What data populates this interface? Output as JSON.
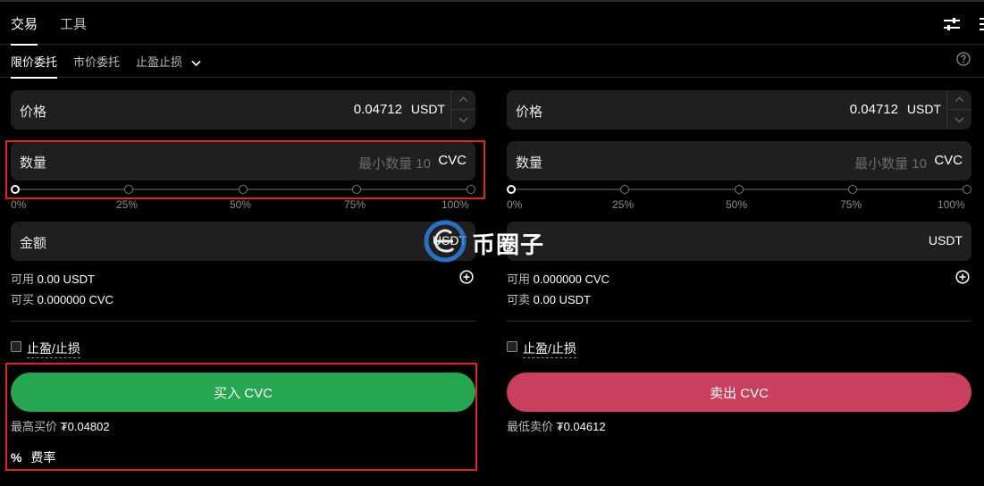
{
  "header": {
    "tabs": [
      {
        "label": "交易",
        "active": true
      },
      {
        "label": "工具",
        "active": false
      }
    ],
    "settings_icon": "sliders-icon"
  },
  "order_types": {
    "limit": "限价委托",
    "market": "市价委托",
    "tpsl": "止盈止损",
    "help_icon": "question-circle-icon"
  },
  "buy": {
    "price_label": "价格",
    "price_value": "0.04712",
    "price_unit": "USDT",
    "qty_label": "数量",
    "qty_placeholder": "最小数量 10",
    "qty_unit": "CVC",
    "slider_ticks": [
      "0%",
      "25%",
      "50%",
      "75%",
      "100%"
    ],
    "slider_value_percent": 0,
    "amount_label": "金额",
    "amount_unit": "USDT",
    "available_key": "可用",
    "available_value": "0.00 USDT",
    "can_key": "可买",
    "can_value": "0.000000 CVC",
    "tpsl_label": "止盈/止损",
    "button": "买入 CVC",
    "best_key": "最高买价",
    "best_value": "₮0.04802",
    "fee_symbol": "%",
    "fee_label": "费率"
  },
  "sell": {
    "price_label": "价格",
    "price_value": "0.04712",
    "price_unit": "USDT",
    "qty_label": "数量",
    "qty_placeholder": "最小数量 10",
    "qty_unit": "CVC",
    "slider_ticks": [
      "0%",
      "25%",
      "50%",
      "75%",
      "100%"
    ],
    "slider_value_percent": 0,
    "amount_unit": "USDT",
    "available_key": "可用",
    "available_value": "0.000000 CVC",
    "can_key": "可卖",
    "can_value": "0.00 USDT",
    "tpsl_label": "止盈/止损",
    "button": "卖出 CVC",
    "best_key": "最低卖价",
    "best_value": "₮0.04612"
  },
  "watermark": {
    "text": "币圈子"
  },
  "colors": {
    "buy": "#26a650",
    "sell": "#c9405f",
    "highlight_box": "#e0241e",
    "field_bg": "#1f1f1f"
  }
}
